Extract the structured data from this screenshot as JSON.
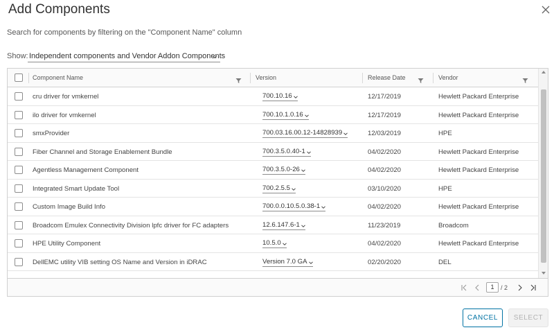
{
  "dialog": {
    "title": "Add Components",
    "subtitle": "Search for components by filtering on the \"Component Name\" column"
  },
  "show": {
    "label": "Show:",
    "selected": "Independent components and Vendor Addon Components"
  },
  "table": {
    "columns": {
      "name": "Component Name",
      "version": "Version",
      "date": "Release Date",
      "vendor": "Vendor"
    },
    "rows": [
      {
        "name": "cru driver for vmkernel",
        "version": "700.10.16",
        "date": "12/17/2019",
        "vendor": "Hewlett Packard Enterprise"
      },
      {
        "name": "ilo driver for vmkernel",
        "version": "700.10.1.0.16",
        "date": "12/17/2019",
        "vendor": "Hewlett Packard Enterprise"
      },
      {
        "name": "smxProvider",
        "version": "700.03.16.00.12-14828939",
        "date": "12/03/2019",
        "vendor": "HPE"
      },
      {
        "name": "Fiber Channel and Storage Enablement Bundle",
        "version": "700.3.5.0.40-1",
        "date": "04/02/2020",
        "vendor": "Hewlett Packard Enterprise"
      },
      {
        "name": "Agentless Management Component",
        "version": "700.3.5.0-26",
        "date": "04/02/2020",
        "vendor": "Hewlett Packard Enterprise"
      },
      {
        "name": "Integrated Smart Update Tool",
        "version": "700.2.5.5",
        "date": "03/10/2020",
        "vendor": "HPE"
      },
      {
        "name": "Custom Image Build Info",
        "version": "700.0.0.10.5.0.38-1",
        "date": "04/02/2020",
        "vendor": "Hewlett Packard Enterprise"
      },
      {
        "name": "Broadcom Emulex Connectivity Division lpfc driver for FC adapters",
        "version": "12.6.147.6-1",
        "date": "11/23/2019",
        "vendor": "Broadcom"
      },
      {
        "name": "HPE Utility Component",
        "version": "10.5.0",
        "date": "04/02/2020",
        "vendor": "Hewlett Packard Enterprise"
      },
      {
        "name": "DellEMC utility VIB setting OS Name and Version in iDRAC",
        "version": "Version 7.0 GA",
        "date": "02/20/2020",
        "vendor": "DEL"
      }
    ]
  },
  "pagination": {
    "current": "1",
    "total": "/ 2"
  },
  "buttons": {
    "cancel": "CANCEL",
    "select": "SELECT"
  },
  "colors": {
    "accent": "#0072a3",
    "disabled": "#b3b3b3"
  }
}
